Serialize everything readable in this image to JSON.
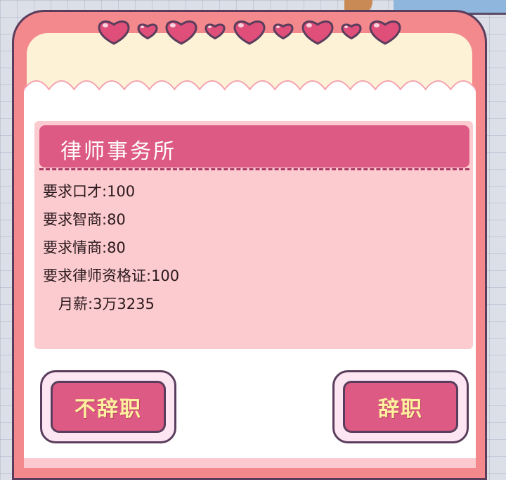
{
  "colors": {
    "frame": "#f3898c",
    "title_bar": "#dd5a84",
    "info_bg": "#fccbd0",
    "button_text": "#fff0a0",
    "heart": "#e04f7a"
  },
  "job": {
    "title": "律师事务所",
    "requirements": [
      "要求口才:100",
      "要求智商:80",
      "要求情商:80",
      "要求律师资格证:100"
    ],
    "salary": "月薪:3万3235"
  },
  "buttons": {
    "stay": "不辞职",
    "quit": "辞职"
  },
  "decorations": {
    "heart_icon": "heart-icon"
  }
}
